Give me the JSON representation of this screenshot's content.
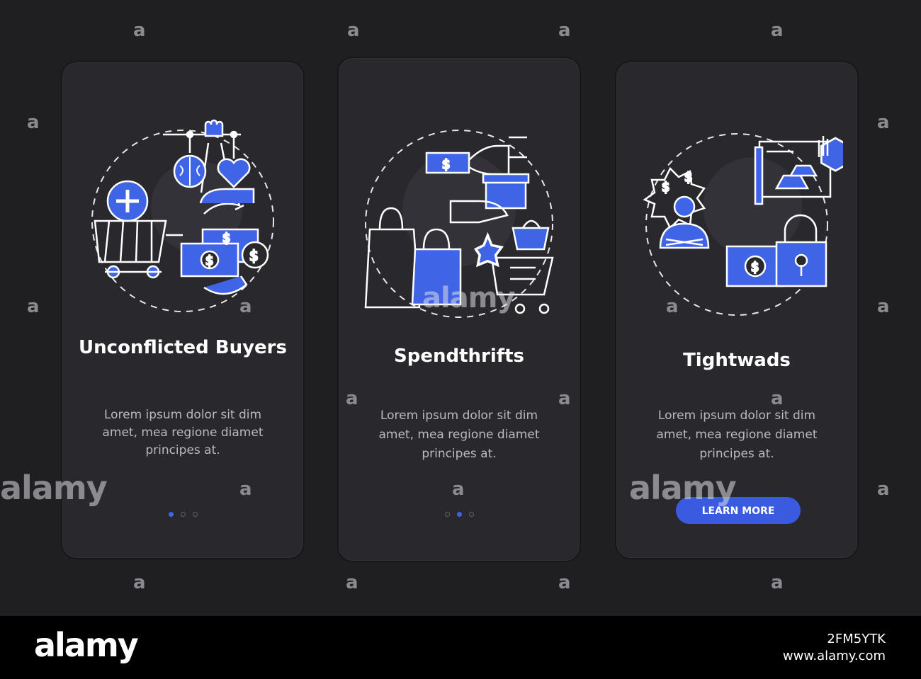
{
  "cards": [
    {
      "title": "Unconflicted Buyers",
      "description": "Lorem ipsum dolor sit dim amet, mea regione diamet principes at.",
      "pagination": {
        "total": 3,
        "active": 1
      },
      "icons": [
        "crane-puppet-icon",
        "brain-icon",
        "heart-icon",
        "add-to-cart-icon",
        "money-exchange-icon"
      ]
    },
    {
      "title": "Spendthrifts",
      "description": "Lorem ipsum dolor sit dim amet, mea regione diamet principes at.",
      "pagination": {
        "total": 3,
        "active": 2
      },
      "icons": [
        "hand-with-cash-icon",
        "hand-with-box-icon",
        "shopping-bags-icon",
        "shopping-cart-icon",
        "basket-icon"
      ]
    },
    {
      "title": "Tightwads",
      "description": "Lorem ipsum dolor sit dim amet, mea regione diamet principes at.",
      "button": "LEARN MORE",
      "icons": [
        "stressed-person-icon",
        "gold-bars-icon",
        "stop-hand-icon",
        "locked-cash-icon"
      ]
    }
  ],
  "watermark": {
    "brand": "alamy",
    "image_id": "2FM5YTK",
    "site": "www.alamy.com",
    "glyph": "a"
  },
  "colors": {
    "background": "#1f1f22",
    "card": "#29292d",
    "accent": "#3f64e6",
    "text": "#ffffff",
    "muted": "#b9b9bf"
  }
}
